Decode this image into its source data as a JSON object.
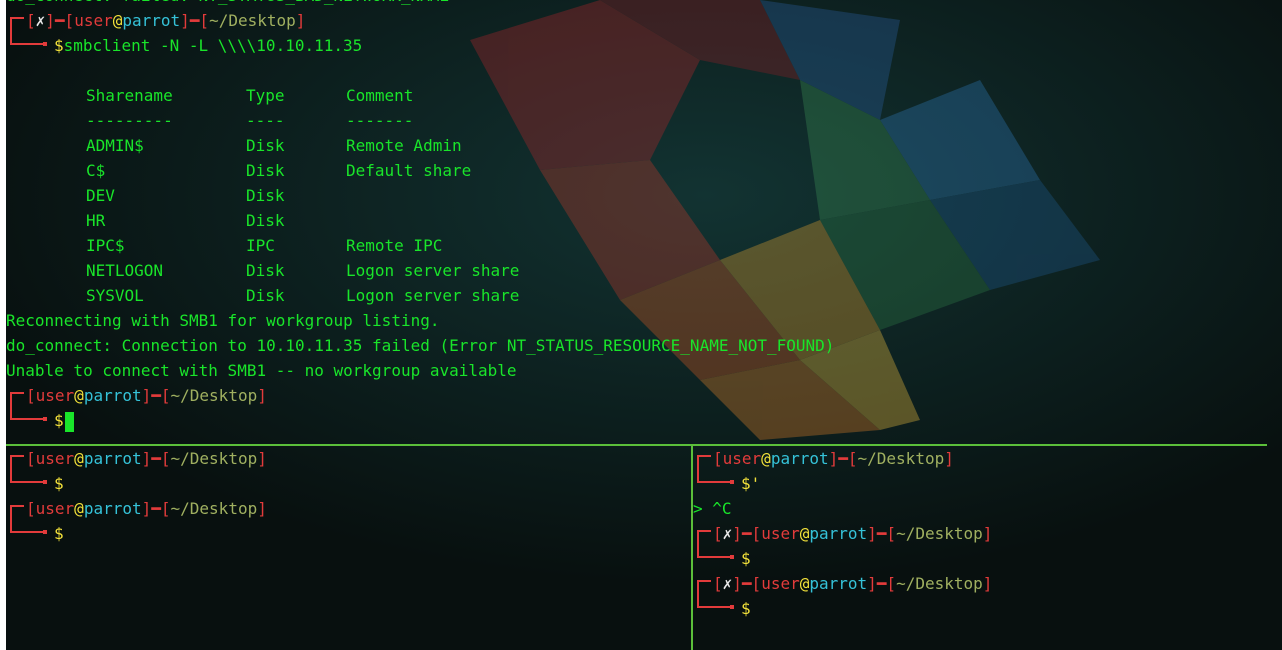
{
  "colors": {
    "green": "#19e52a",
    "red": "#e23b3b",
    "cyan": "#35c2d8",
    "yellow": "#f2e13a",
    "divider": "#5bbf3a",
    "background": "#0b1514"
  },
  "prompt": {
    "user": "user",
    "at": "@",
    "host": "parrot",
    "path": "~/Desktop",
    "error_mark": "✗",
    "symbol": "$"
  },
  "top": {
    "partial_line": "do_connect: failed: NT_STATUS_BAD_NETWORK_NAME",
    "command": "smbclient -N -L \\\\\\\\10.10.11.35",
    "headers": [
      "Sharename",
      "Type",
      "Comment"
    ],
    "separators": [
      "---------",
      "----",
      "-------"
    ],
    "shares": [
      {
        "name": "ADMIN$",
        "type": "Disk",
        "comment": "Remote Admin"
      },
      {
        "name": "C$",
        "type": "Disk",
        "comment": "Default share"
      },
      {
        "name": "DEV",
        "type": "Disk",
        "comment": ""
      },
      {
        "name": "HR",
        "type": "Disk",
        "comment": ""
      },
      {
        "name": "IPC$",
        "type": "IPC",
        "comment": "Remote IPC"
      },
      {
        "name": "NETLOGON",
        "type": "Disk",
        "comment": "Logon server share"
      },
      {
        "name": "SYSVOL",
        "type": "Disk",
        "comment": "Logon server share"
      }
    ],
    "messages": [
      "Reconnecting with SMB1 for workgroup listing.",
      "do_connect: Connection to 10.10.11.35 failed (Error NT_STATUS_RESOURCE_NAME_NOT_FOUND)",
      "Unable to connect with SMB1 -- no workgroup available"
    ]
  },
  "bottom_right": {
    "quote_input": "'",
    "interrupt": "> ^C"
  }
}
